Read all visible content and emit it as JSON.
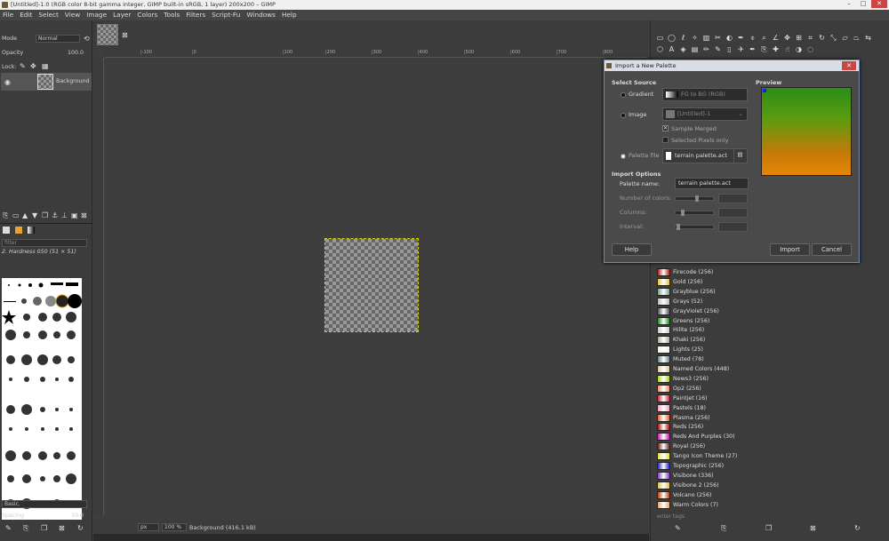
{
  "window": {
    "title": "[Untitled]-1.0 (RGB color 8-bit gamma integer, GIMP built-in sRGB, 1 layer) 200x200 – GIMP",
    "min": "–",
    "max": "□",
    "close": "✕"
  },
  "menu": [
    "File",
    "Edit",
    "Select",
    "View",
    "Image",
    "Layer",
    "Colors",
    "Tools",
    "Filters",
    "Script-Fu",
    "Windows",
    "Help"
  ],
  "layers": {
    "mode_label": "Mode",
    "mode_value": "Normal",
    "opacity_label": "Opacity",
    "opacity_value": "100.0",
    "lock_label": "Lock:",
    "layer_name": "Background"
  },
  "brushes": {
    "filter_placeholder": "filter",
    "brush_name": "2. Hardness 050 (51 × 51)",
    "preset": "Basic.",
    "spacing_label": "Spacing",
    "spacing_value": "10.0"
  },
  "ruler_ticks": [
    "|-100",
    "|0",
    "|100",
    "|200",
    "|300",
    "|400",
    "|500",
    "|600",
    "|700",
    "|800"
  ],
  "status": {
    "unit": "px",
    "zoom": "100 %",
    "info": "Background (416.1 kB)"
  },
  "dialog": {
    "title": "Import a New Palette",
    "select_source": "Select Source",
    "gradient_label": "Gradient",
    "gradient_value": "FG to BG (RGB)",
    "image_label": "Image",
    "image_value": "[Untitled]-1",
    "sample_merged": "Sample Merged",
    "selected_pixels": "Selected Pixels only",
    "palette_file_label": "Palette file",
    "palette_file_value": "terrain palette.act",
    "preview_label": "Preview",
    "import_options": "Import Options",
    "palette_name_label": "Palette name:",
    "palette_name_value": "terrain palette.act",
    "num_colors_label": "Number of colors:",
    "columns_label": "Columns:",
    "interval_label": "Interval:",
    "help": "Help",
    "import": "Import",
    "cancel": "Cancel"
  },
  "palettes": [
    {
      "name": "Firecode (256)",
      "color": "#c02010"
    },
    {
      "name": "Gold (256)",
      "color": "#e8c040"
    },
    {
      "name": "Grayblue (256)",
      "color": "#7aa090"
    },
    {
      "name": "Grays (52)",
      "color": "#bbbbbb"
    },
    {
      "name": "GrayViolet (256)",
      "color": "#555060"
    },
    {
      "name": "Greens (256)",
      "color": "#208a20"
    },
    {
      "name": "Hilite (256)",
      "color": "#c8c8c8"
    },
    {
      "name": "Khaki (256)",
      "color": "#b0b098"
    },
    {
      "name": "Lights (25)",
      "color": "#f0f0e0"
    },
    {
      "name": "Muted (78)",
      "color": "#6a8a90"
    },
    {
      "name": "Named Colors (448)",
      "color": "#d8c8a0"
    },
    {
      "name": "News3 (256)",
      "color": "#a8d800"
    },
    {
      "name": "Op2 (256)",
      "color": "#e89060"
    },
    {
      "name": "Paintjet (16)",
      "color": "#e02040"
    },
    {
      "name": "Pastels (18)",
      "color": "#f0a0c0"
    },
    {
      "name": "Plasma (256)",
      "color": "#f06020"
    },
    {
      "name": "Reds (256)",
      "color": "#b01010"
    },
    {
      "name": "Reds And Purples (30)",
      "color": "#c020a0"
    },
    {
      "name": "Royal (256)",
      "color": "#6a2a20"
    },
    {
      "name": "Tango Icon Theme (27)",
      "color": "#e0e040"
    },
    {
      "name": "Topographic (256)",
      "color": "#2a20c0"
    },
    {
      "name": "Visibone (336)",
      "color": "#8040c0"
    },
    {
      "name": "Visibone 2 (256)",
      "color": "#e0c040"
    },
    {
      "name": "Volcano (256)",
      "color": "#c04010"
    },
    {
      "name": "Warm Colors (7)",
      "color": "#f0a060"
    }
  ],
  "tags_placeholder": "enter tags"
}
